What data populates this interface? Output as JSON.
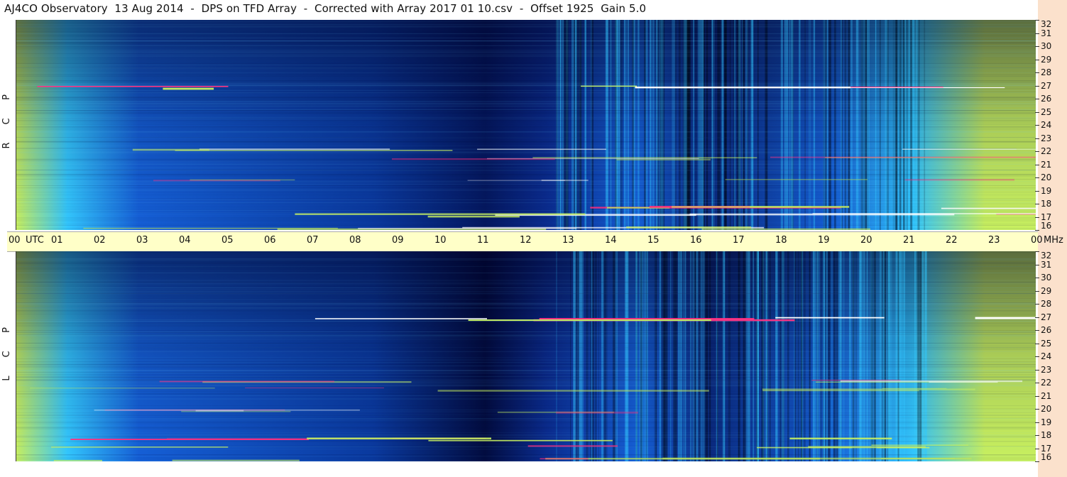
{
  "title": "AJ4CO Observatory  13 Aug 2014  -  DPS on TFD Array  -  Corrected with Array 2017 01 10.csv  -  Offset 1925  Gain 5.0",
  "panels": [
    {
      "id": "rcp",
      "label_letters": [
        "R",
        "C",
        "P"
      ]
    },
    {
      "id": "lcp",
      "label_letters": [
        "L",
        "C",
        "P"
      ]
    }
  ],
  "utc_axis": {
    "unit_label": "UTC",
    "ticks": [
      "00",
      "01",
      "02",
      "03",
      "04",
      "05",
      "06",
      "07",
      "08",
      "09",
      "10",
      "11",
      "12",
      "13",
      "14",
      "15",
      "16",
      "17",
      "18",
      "19",
      "20",
      "21",
      "22",
      "23",
      "00"
    ],
    "right_unit": "MHz"
  },
  "freq_axis": {
    "ticks": [
      "32",
      "31",
      "30",
      "29",
      "28",
      "27",
      "26",
      "25",
      "24",
      "23",
      "22",
      "21",
      "20",
      "19",
      "18",
      "17",
      "16"
    ],
    "range_mhz": [
      16,
      32
    ]
  },
  "chart_data": {
    "type": "heatmap",
    "title": "AJ4CO Observatory  13 Aug 2014  -  DPS on TFD Array  -  Corrected with Array 2017 01 10.csv  -  Offset 1925  Gain 5.0",
    "x_axis": {
      "label": "UTC",
      "range_hours": [
        0,
        24
      ]
    },
    "y_axis": {
      "label": "MHz",
      "range": [
        16,
        32
      ]
    },
    "series": [
      {
        "name": "RCP"
      },
      {
        "name": "LCP"
      }
    ],
    "colors": {
      "low": "#000a3a",
      "mid": "#1560d8",
      "high": "#33c8ff",
      "hot": "#c8f060",
      "peak": "#ff3080"
    }
  }
}
